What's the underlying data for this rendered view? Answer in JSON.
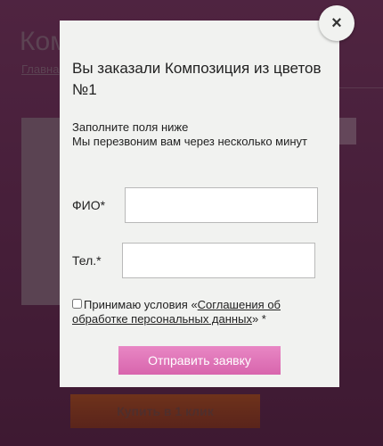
{
  "background": {
    "title": "Ком",
    "breadcrumb": "Главна",
    "buy_button": "Купить в 1 клик"
  },
  "modal": {
    "title": "Вы заказали Композиция из цветов №1",
    "hint_line1": "Заполните поля ниже",
    "hint_line2": "Мы перезвоним вам через несколько минут",
    "name_label": "ФИО*",
    "phone_label": "Тел.*",
    "consent_prefix": "Принимаю условия «",
    "consent_link": "Соглашения об обработке персональных данных",
    "consent_suffix": "» *",
    "submit_label": "Отправить заявку",
    "close_symbol": "×"
  },
  "colors": {
    "accent": "#d865ad"
  }
}
